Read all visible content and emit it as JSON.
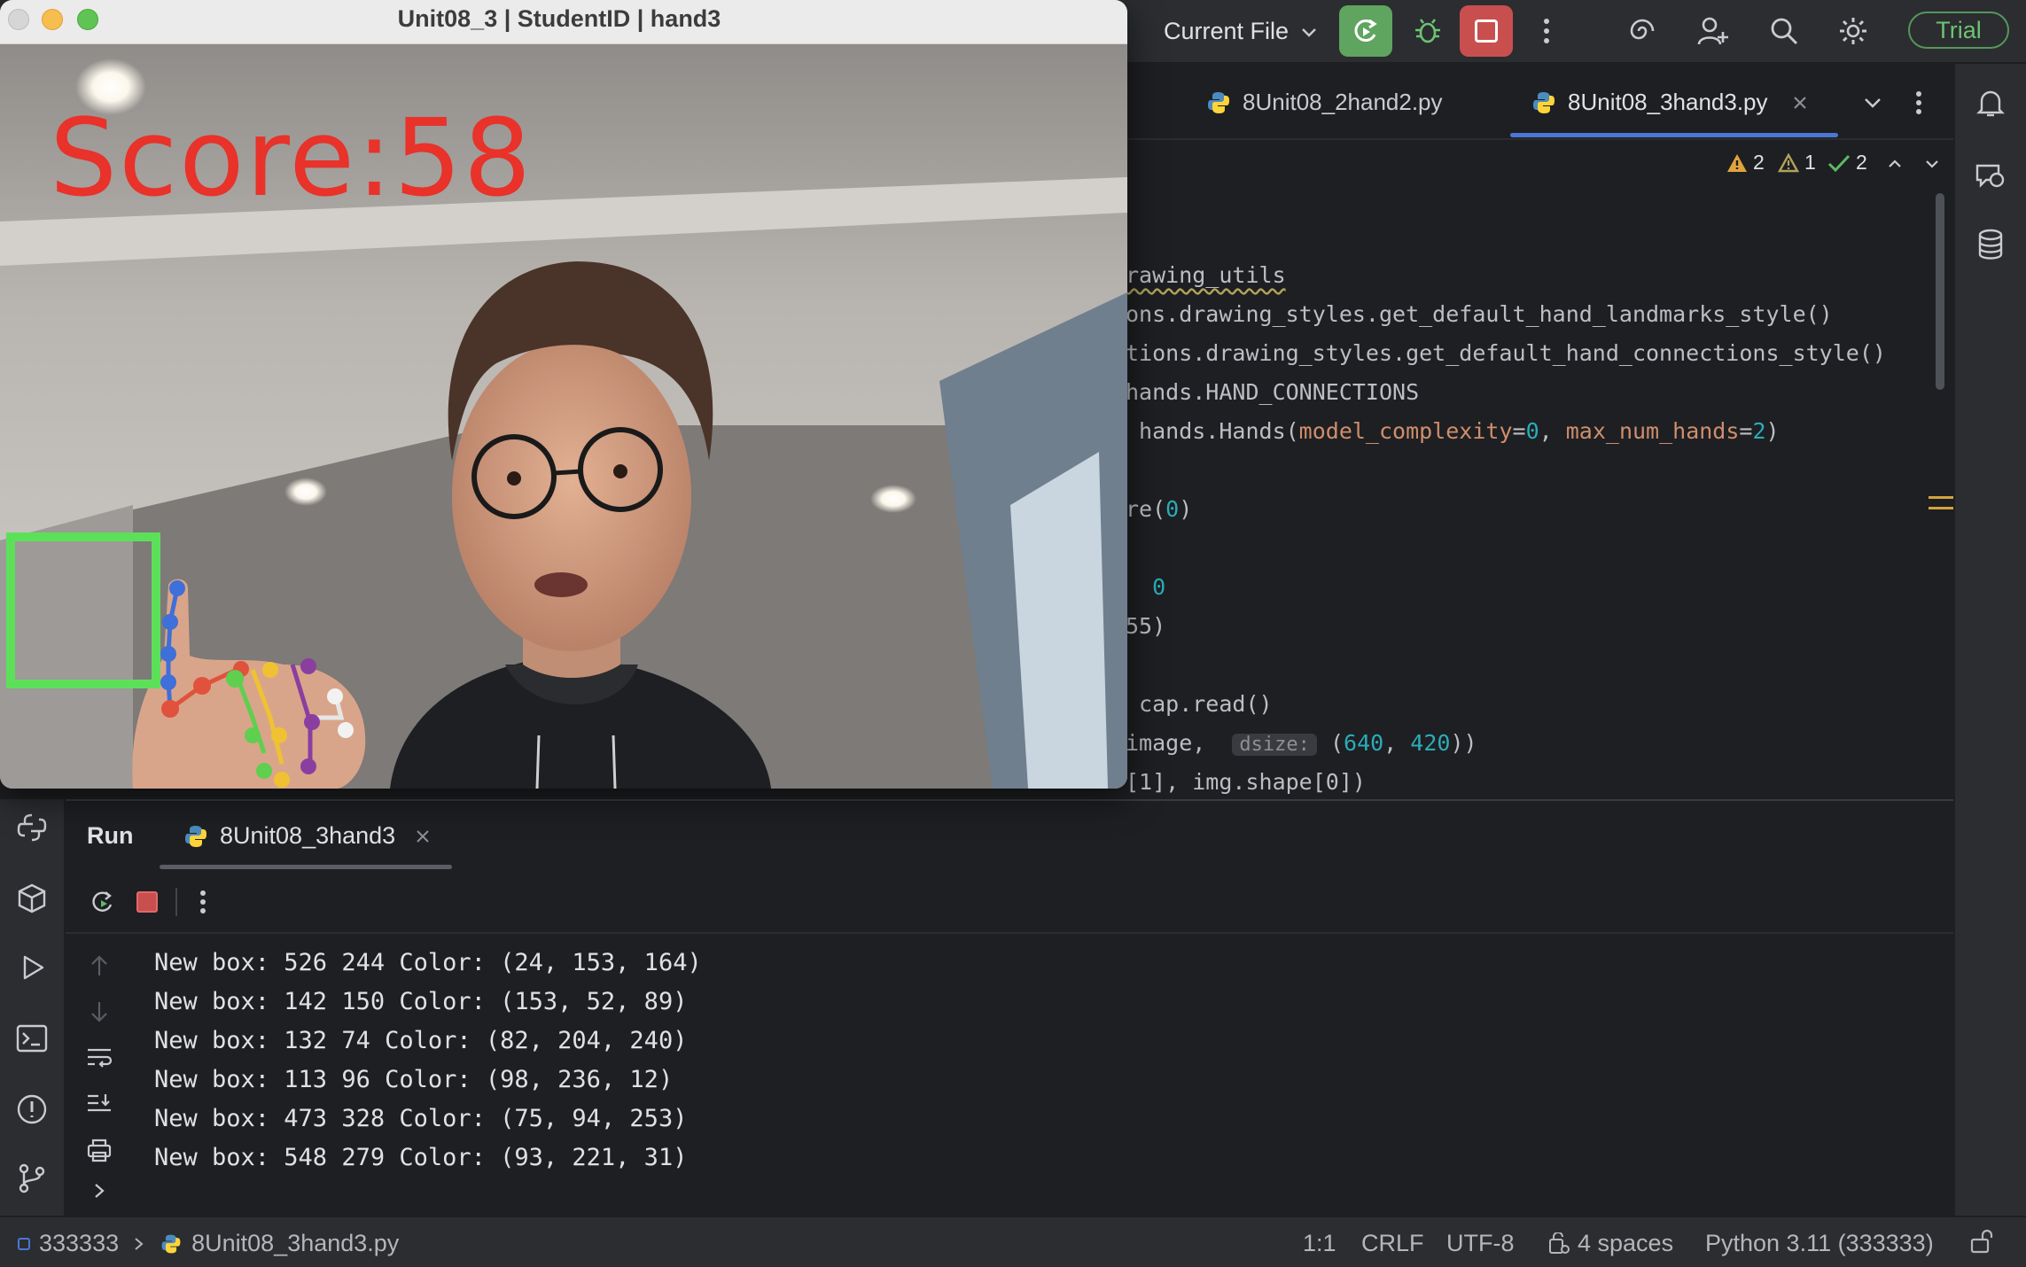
{
  "topbar": {
    "run_config": "Current File",
    "trial": "Trial"
  },
  "tabs": [
    {
      "label": "8Unit08_2hand2.py"
    },
    {
      "label": "8Unit08_3hand3.py"
    }
  ],
  "inspections": {
    "warnings": "2",
    "weak_warnings": "1",
    "ok": "2"
  },
  "code_lines": [
    [
      "rawing_utils"
    ],
    [
      "ons.drawing_styles.get_default_hand_landmarks_style()"
    ],
    [
      "tions.drawing_styles.get_default_hand_connections_style()"
    ],
    [
      "hands.HAND_CONNECTIONS"
    ],
    [
      " hands.Hands(",
      "model_complexity",
      "=",
      "0",
      ", ",
      "max_num_hands",
      "=",
      "2",
      ")"
    ],
    [
      "re(",
      "0",
      ")"
    ],
    [
      "  0"
    ],
    [
      "55)"
    ],
    [
      " cap.read()"
    ],
    [
      "image,  ",
      "dsize:",
      " (",
      "640",
      ", ",
      "420",
      "))"
    ],
    [
      "[1], img.shape[0])"
    ]
  ],
  "run_panel": {
    "title": "Run",
    "tab": "8Unit08_3hand3",
    "output": [
      "New box: 526 244 Color: (24, 153, 164)",
      "New box: 142 150 Color: (153, 52, 89)",
      "New box: 132 74 Color: (82, 204, 240)",
      "New box: 113 96 Color: (98, 236, 12)",
      "New box: 473 328 Color: (75, 94, 253)",
      "New box: 548 279 Color: (93, 221, 31)"
    ]
  },
  "statusbar": {
    "project": "333333",
    "file": "8Unit08_3hand3.py",
    "position": "1:1",
    "line_sep": "CRLF",
    "encoding": "UTF-8",
    "indent": "4 spaces",
    "interpreter": "Python 3.11 (333333)"
  },
  "camera": {
    "title": "Unit08_3 | StudentID | hand3",
    "score": "Score:58"
  },
  "colors": {
    "accent": "#4a76d6",
    "run_green": "#5fa45f",
    "stop_red": "#c94f4f",
    "score_red": "#e8322a",
    "box_green": "#5ce05a"
  }
}
